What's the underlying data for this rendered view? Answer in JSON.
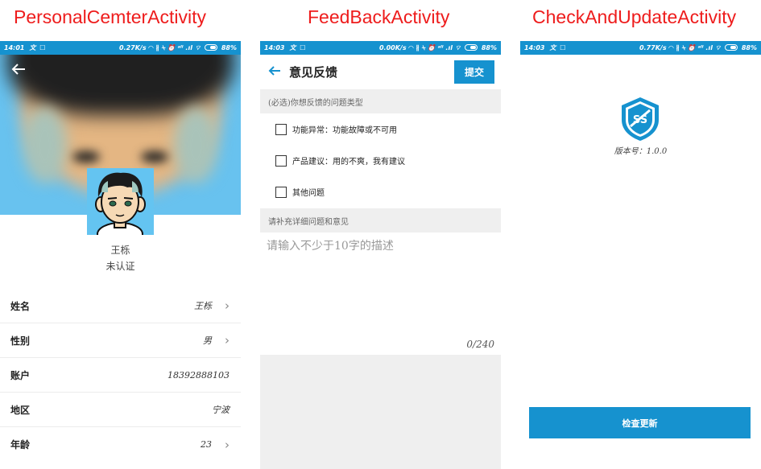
{
  "captions": {
    "personal": "PersonalCemterActivity",
    "feedback": "FeedBackActivity",
    "update": "CheckAndUpdateActivity"
  },
  "colors": {
    "accent": "#1692cf",
    "caption": "#ee1c1c",
    "header_bg": "#68c2ef"
  },
  "status_bars": [
    {
      "time": "14:01",
      "left_icons": "文 ☐",
      "speed": "0.27K/s",
      "battery": "88%"
    },
    {
      "time": "14:03",
      "left_icons": "文 ☐",
      "speed": "0.00K/s",
      "battery": "88%"
    },
    {
      "time": "14:03",
      "left_icons": "文 ☐",
      "speed": "0.77K/s",
      "battery": "88%"
    }
  ],
  "status_icons": "◠ ∦ ⍀ ⏰ ᵃˡˡ .ıl ⌔",
  "personal": {
    "back_icon": "arrow-left",
    "name": "王栎",
    "status": "未认证",
    "chevron": "›",
    "rows": [
      {
        "label": "姓名",
        "value": "王栎",
        "has_chevron": true
      },
      {
        "label": "性别",
        "value": "男",
        "has_chevron": true
      },
      {
        "label": "账户",
        "value": "18392888103",
        "has_chevron": false
      },
      {
        "label": "地区",
        "value": "宁波",
        "has_chevron": false
      },
      {
        "label": "年龄",
        "value": "23",
        "has_chevron": true
      }
    ]
  },
  "feedback": {
    "title": "意见反馈",
    "submit_label": "提交",
    "type_header": "(必选)你想反馈的问题类型",
    "options": [
      "功能异常：功能故障或不可用",
      "产品建议：用的不爽，我有建议",
      "其他问题"
    ],
    "detail_header": "请补充详细问题和意见",
    "desc_placeholder": "请输入不少于10字的描述",
    "counter": "0/240"
  },
  "update": {
    "logo_text": "SS",
    "version_label": "版本号：1.0.0",
    "check_button_label": "检查更新"
  }
}
